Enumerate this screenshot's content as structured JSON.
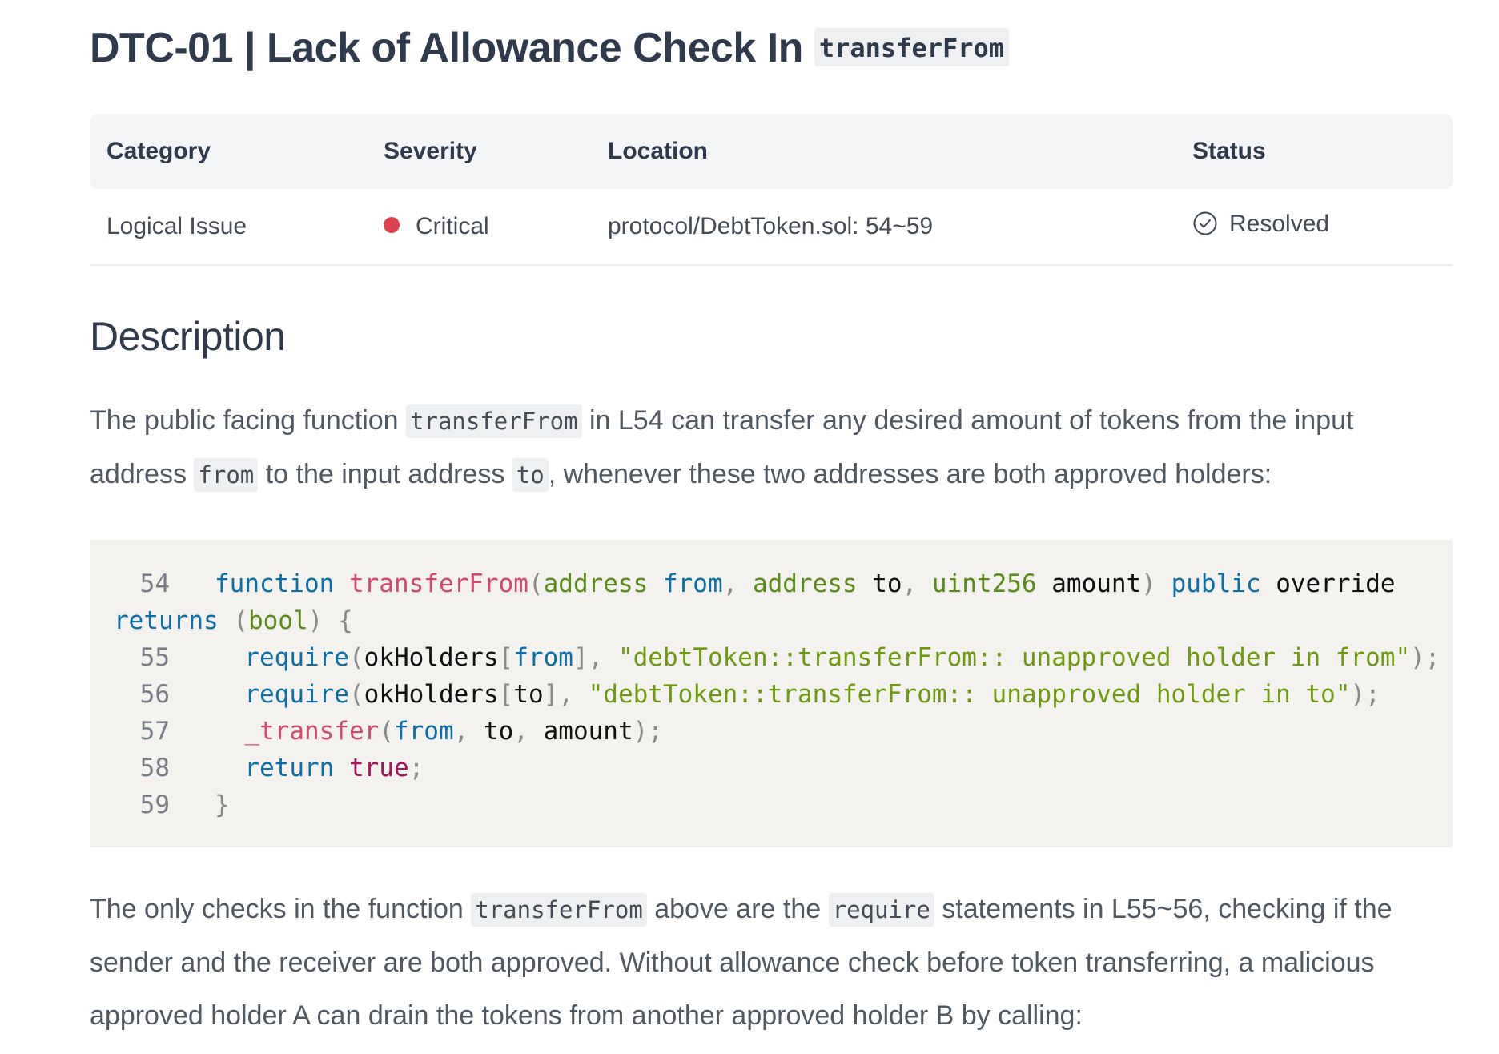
{
  "header": {
    "title_text": "DTC-01 | Lack of Allowance Check In",
    "title_code": "transferFrom"
  },
  "table": {
    "headers": [
      "Category",
      "Severity",
      "Location",
      "Status"
    ],
    "row": {
      "category": "Logical Issue",
      "severity": "Critical",
      "location": "protocol/DebtToken.sol: 54~59",
      "status": "Resolved"
    },
    "colors": {
      "critical": "#e0414f"
    }
  },
  "description": {
    "heading": "Description",
    "para1": {
      "t1": "The public facing function ",
      "c1": "transferFrom",
      "t2": " in L54 can transfer any desired amount of tokens from the input address ",
      "c2": "from",
      "t3": " to the input address ",
      "c3": "to",
      "t4": ", whenever these two addresses are both approved holders:"
    },
    "code": {
      "ln": [
        "54",
        "55",
        "56",
        "57",
        "58",
        "59"
      ],
      "l54": {
        "indent": "   ",
        "kw_function": "function",
        "sp1": " ",
        "fn_name": "transferFrom",
        "p_open": "(",
        "ty_address1": "address",
        "sp2": " ",
        "arg_from": "from",
        "comma1": ", ",
        "ty_address2": "address",
        "sp3": " ",
        "arg_to": "to",
        "comma2": ", ",
        "ty_uint": "uint256",
        "sp4": " ",
        "arg_amount": "amount",
        "p_close": ")",
        "sp5": " ",
        "kw_public": "public",
        "sp6": " ",
        "kw_override": "override"
      },
      "l54b": {
        "kw_returns": "returns",
        "sp": " ",
        "p_open": "(",
        "ty_bool": "bool",
        "p_close": ")",
        "brace": " {"
      },
      "l55": {
        "indent": "     ",
        "kw_require": "require",
        "p_open": "(",
        "ident": "okHolders",
        "b_open": "[",
        "arg": "from",
        "b_close": "]",
        "comma": ", ",
        "str": "\"debtToken::transferFrom:: unapproved holder in from\"",
        "end": ");"
      },
      "l56": {
        "indent": "     ",
        "kw_require": "require",
        "p_open": "(",
        "ident": "okHolders",
        "b_open": "[",
        "arg": "to",
        "b_close": "]",
        "comma": ", ",
        "str": "\"debtToken::transferFrom:: unapproved holder in to\"",
        "end": ");"
      },
      "l57": {
        "indent": "     ",
        "fn": "_transfer",
        "p_open": "(",
        "arg_from": "from",
        "c1": ", ",
        "arg_to": "to",
        "c2": ", ",
        "arg_amount": "amount",
        "end": ");"
      },
      "l58": {
        "indent": "     ",
        "kw_return": "return",
        "sp": " ",
        "lit_true": "true",
        "end": ";"
      },
      "l59": {
        "indent": "   ",
        "brace": "}"
      }
    },
    "para2": {
      "t1": "The only checks in the function ",
      "c1": "transferFrom",
      "t2": " above are the ",
      "c2": "require",
      "t3": " statements in L55~56, checking if the sender and the receiver are both approved. Without allowance check before token transferring, a malicious approved holder A can drain the tokens from another approved holder B by calling:"
    }
  }
}
